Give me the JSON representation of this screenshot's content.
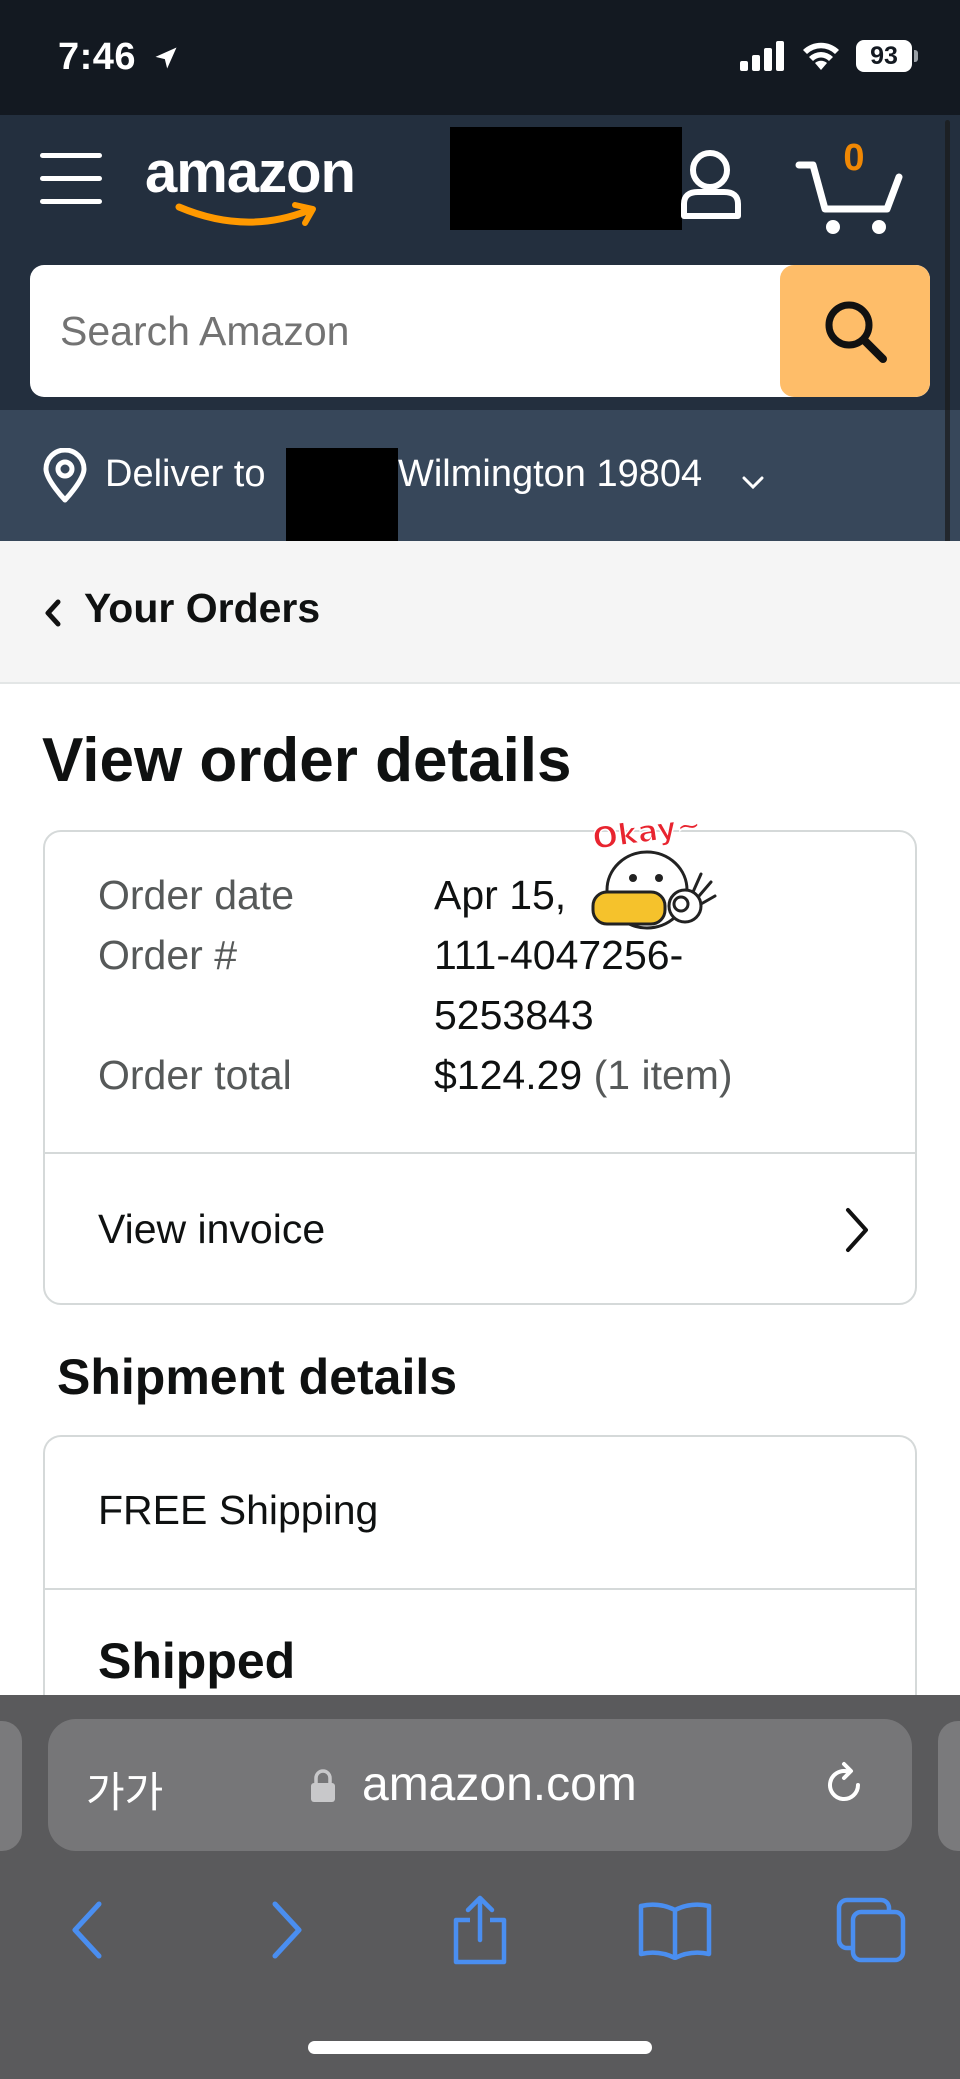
{
  "status_bar": {
    "time": "7:46",
    "battery": "93"
  },
  "header": {
    "logo": "amazon",
    "cart_count": "0",
    "search": {
      "placeholder": "Search Amazon"
    },
    "deliver_label": "Deliver to",
    "deliver_location": "Wilmington 19804"
  },
  "breadcrumb": {
    "label": "Your Orders"
  },
  "page": {
    "title": "View order details"
  },
  "order_summary": {
    "order_date_label": "Order date",
    "order_date_value": "Apr 15,",
    "order_number_label": "Order #",
    "order_number_line1": "111-4047256-",
    "order_number_line2": "5253843",
    "order_total_label": "Order total",
    "order_total_value": "$124.29",
    "order_total_items": "(1 item)",
    "view_invoice": "View invoice"
  },
  "sticker": {
    "text": "Okay~"
  },
  "shipment": {
    "title": "Shipment details",
    "shipping_speed": "FREE Shipping",
    "status": "Shipped"
  },
  "browser": {
    "aa_label": "가가",
    "url": "amazon.com"
  },
  "colors": {
    "status_bar_bg": "#131921",
    "header_bg": "#232f3e",
    "deliver_bg": "#37475a",
    "search_button": "#febd69",
    "cart_count": "#f08804",
    "browser_blue": "#4a8ef0"
  }
}
